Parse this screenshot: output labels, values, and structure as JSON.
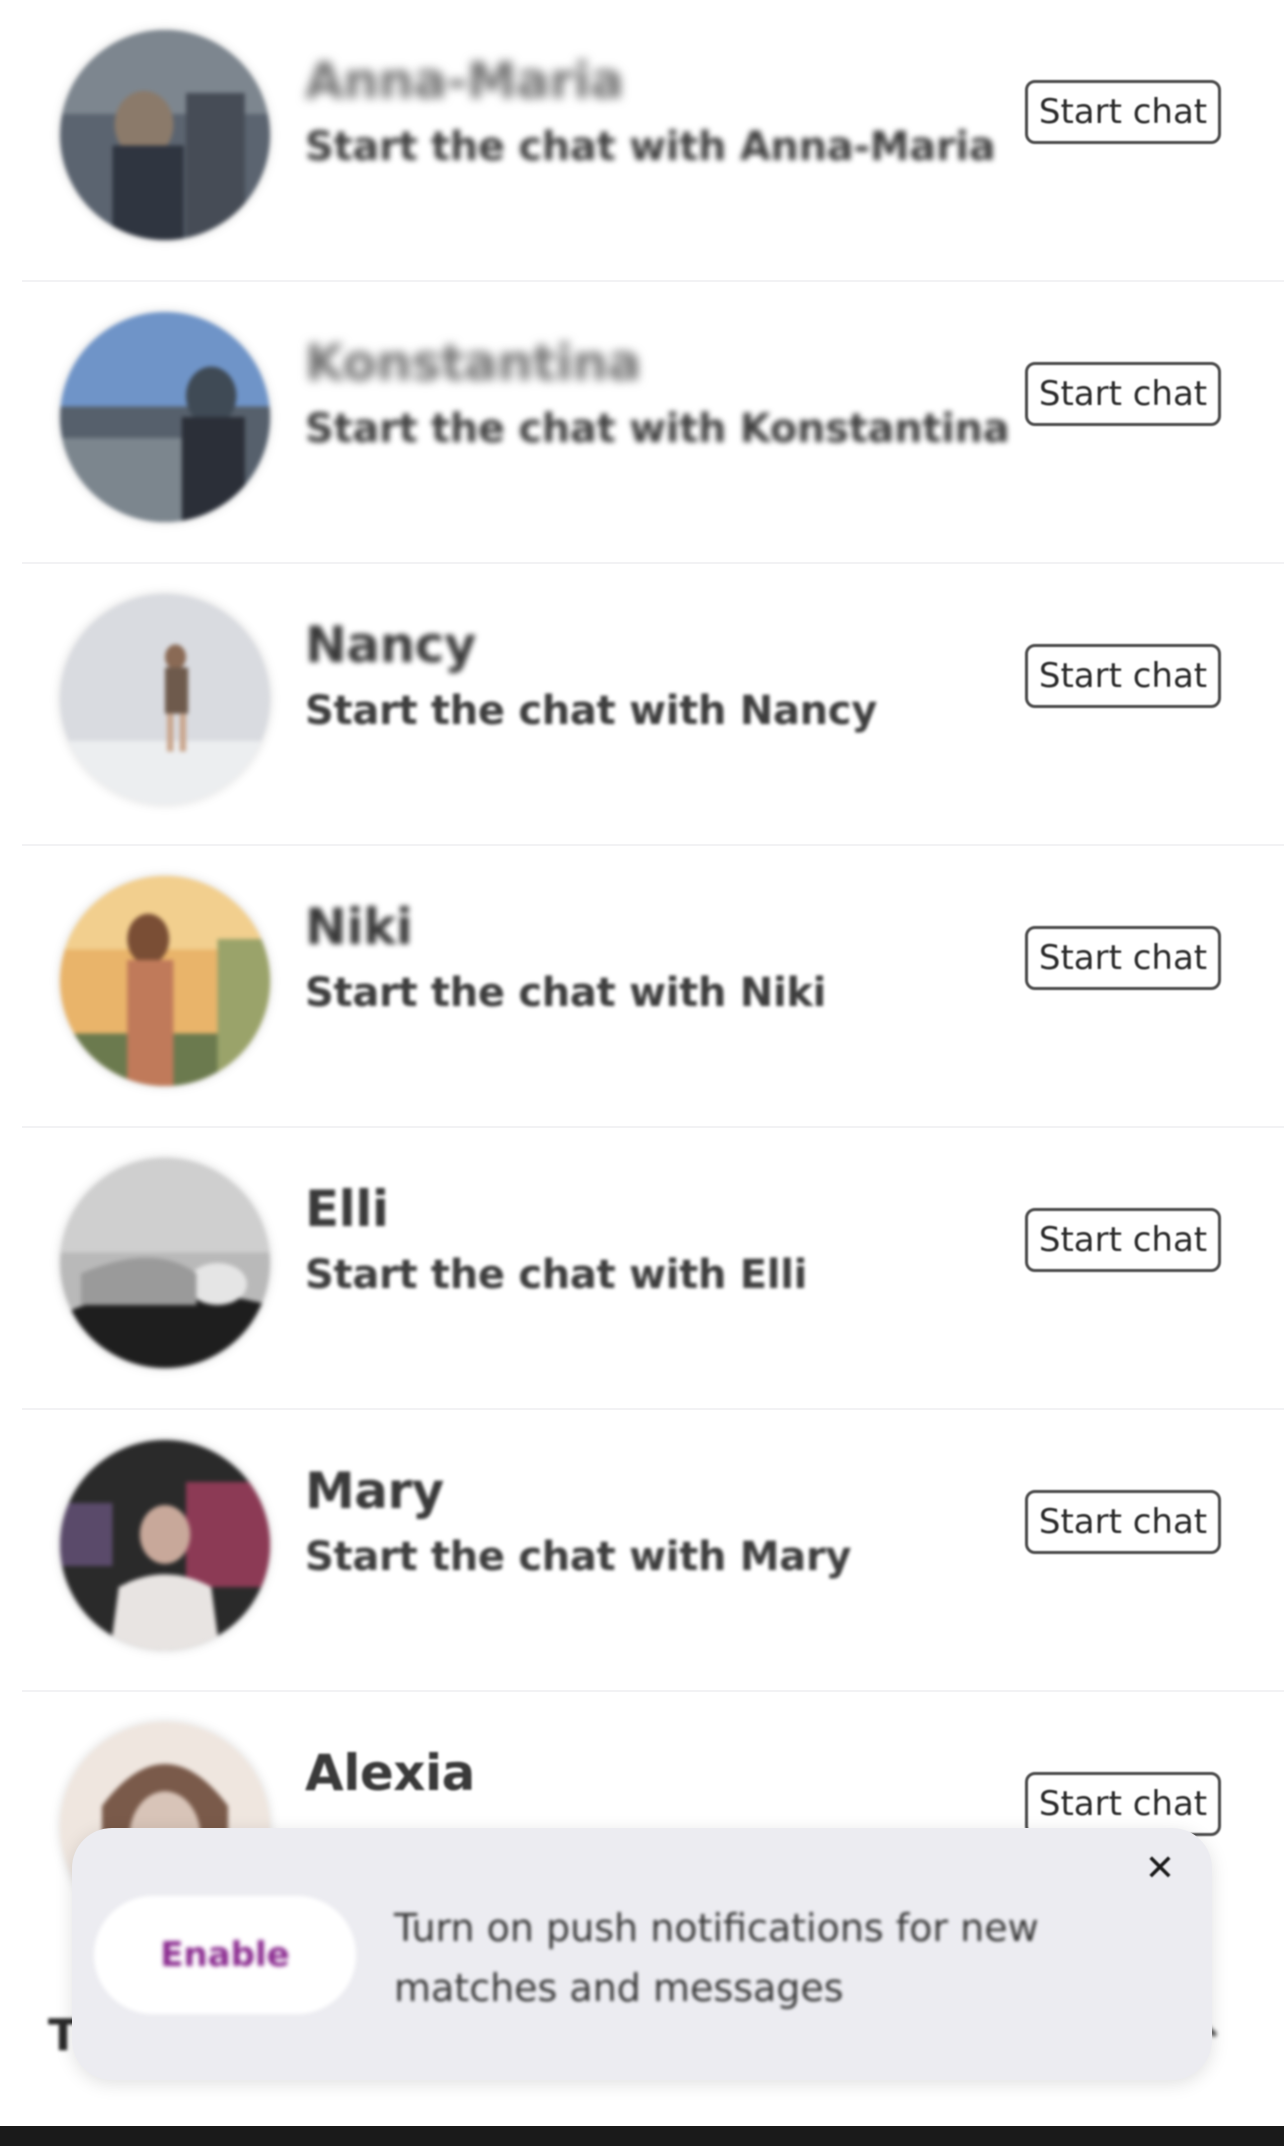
{
  "contacts": [
    {
      "name": "Anna-Maria",
      "subtitle": "Start the chat with Anna-Maria",
      "button": "Start chat",
      "avatar_colors": [
        "#5b6470",
        "#8b7a6a",
        "#2f3540"
      ]
    },
    {
      "name": "Konstantina",
      "subtitle": "Start the chat with Konstantina",
      "button": "Start chat",
      "avatar_colors": [
        "#6f94c8",
        "#3f4a55",
        "#2b2f38"
      ]
    },
    {
      "name": "Nancy",
      "subtitle": "Start the chat with Nancy",
      "button": "Start chat",
      "avatar_colors": [
        "#d9dbe0",
        "#8a6a55",
        "#eeeeee"
      ]
    },
    {
      "name": "Niki",
      "subtitle": "Start the chat with Niki",
      "button": "Start chat",
      "avatar_colors": [
        "#e9b46a",
        "#c07a5a",
        "#6b7a4e"
      ]
    },
    {
      "name": "Elli",
      "subtitle": "Start the chat with Elli",
      "button": "Start chat",
      "avatar_colors": [
        "#b9b9b9",
        "#e5e5e5",
        "#1e1e1e"
      ]
    },
    {
      "name": "Mary",
      "subtitle": "Start the chat with Mary",
      "button": "Start chat",
      "avatar_colors": [
        "#2a2a2a",
        "#c8a89a",
        "#8c3a55"
      ]
    },
    {
      "name": "Alexia",
      "subtitle": "",
      "button": "Start chat",
      "avatar_colors": [
        "#d8c4b8",
        "#7a5a4a",
        "#efe6df"
      ]
    }
  ],
  "toast": {
    "enable_label": "Enable",
    "message": "Turn on push notifications for new matches and messages",
    "close_glyph": "✕"
  },
  "bottom_partial_text": "T",
  "colors": {
    "enable_text": "#8a2a8f",
    "toast_background": "#ececf1"
  }
}
